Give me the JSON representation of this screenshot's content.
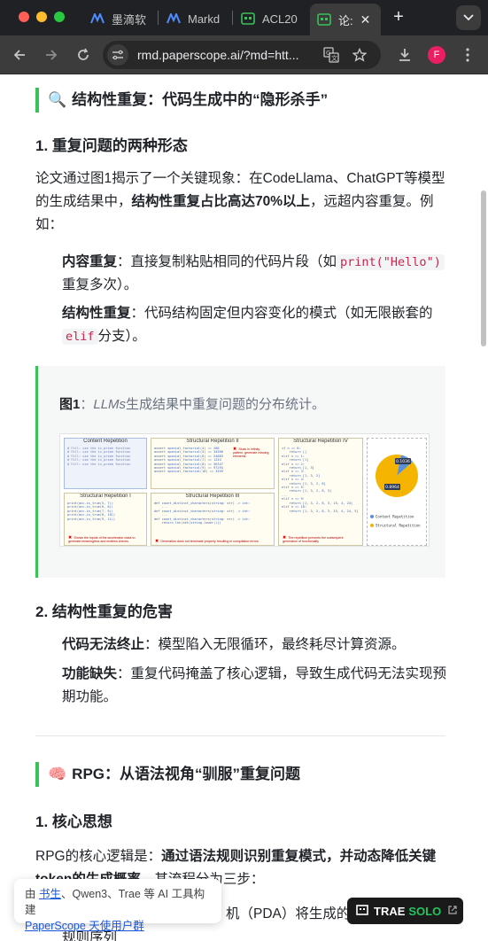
{
  "browser": {
    "tabs": [
      {
        "label": "墨滴软",
        "icon": "mdnice-icon"
      },
      {
        "label": "Markd",
        "icon": "mdnice-icon"
      },
      {
        "label": "ACL20",
        "icon": "paperscope-icon"
      },
      {
        "label": "论:",
        "icon": "paperscope-icon",
        "active": true
      }
    ],
    "url": "rmd.paperscope.ai/?md=htt...",
    "profile_initial": "F"
  },
  "article": {
    "section1_title": "结构性重复：代码生成中的“隐形杀手”",
    "section1_emoji": "🔍",
    "sub1_title": "1. 重复问题的两种形态",
    "p1_a": "论文通过图1揭示了一个关键现象：在CodeLlama、ChatGPT等模型的生成结果中，",
    "p1_b": "结构性重复占比高达70%以上",
    "p1_c": "，远超内容重复。例如：",
    "li1_label": "内容重复",
    "li1_text": "：直接复制粘贴相同的代码片段（如",
    "li1_code": "print(\"Hello\")",
    "li1_tail": "重复多次）。",
    "li2_label": "结构性重复",
    "li2_text": "：代码结构固定但内容变化的模式（如无限嵌套的",
    "li2_code": "elif",
    "li2_tail": "分支）。",
    "figure_caption_label": "图1",
    "figure_caption_sep": "：",
    "figure_caption_italic": "LLMs",
    "figure_caption_text": "生成结果中重复问题的分布统计。",
    "figure": {
      "panels": [
        {
          "title": "Content Repetition"
        },
        {
          "title": "Structural Repetition II",
          "note": "Stuck in infinity pattern, generate missing elements"
        },
        {
          "title": "Structural Repetition IV",
          "note": "The repetition prevents the subsequent generation of functionality"
        },
        {
          "title": "Structural Repetition I",
          "note": "Shows the inputs of the accelerator class to generate meaningless and endless checks"
        },
        {
          "title": "Structural Repetition III",
          "note": "Generation does not terminate properly resulting in compilation errors"
        }
      ],
      "pie": {
        "slices": [
          {
            "label": "Content Repetition",
            "value": 0.1036,
            "color": "#5b8fd6"
          },
          {
            "label": "Structural Repetition",
            "value": 0.8964,
            "color": "#f4b400"
          }
        ],
        "labels": [
          "0.1036",
          "0.8964"
        ]
      }
    },
    "sub2_title": "2. 结构性重复的危害",
    "li3_label": "代码无法终止",
    "li3_text": "：模型陷入无限循环，最终耗尽计算资源。",
    "li4_label": "功能缺失",
    "li4_text": "：重复代码掩盖了核心逻辑，导致生成代码无法实现预期功能。",
    "section2_title": "RPG：从语法视角“驯服”重复问题",
    "section2_emoji": "🧠",
    "sub3_title": "1. 核心思想",
    "p2_a": "RPG的核心逻辑是：",
    "p2_b": "通过语法规则识别重复模式，并动态降低关键token的生成概率",
    "p2_c": "。其流程分为三步：",
    "li5_visible": "机（PDA）将生成的代",
    "li6_visible": "规则序列"
  },
  "overlay": {
    "credit_prefix": "由 ",
    "credit_link1": "书生",
    "credit_middle": "、Qwen3、Trae 等 AI 工具构建",
    "credit_link2": "PaperScope 天使用户群",
    "trae_label": "TRAE",
    "trae_solo": "SOLO"
  }
}
